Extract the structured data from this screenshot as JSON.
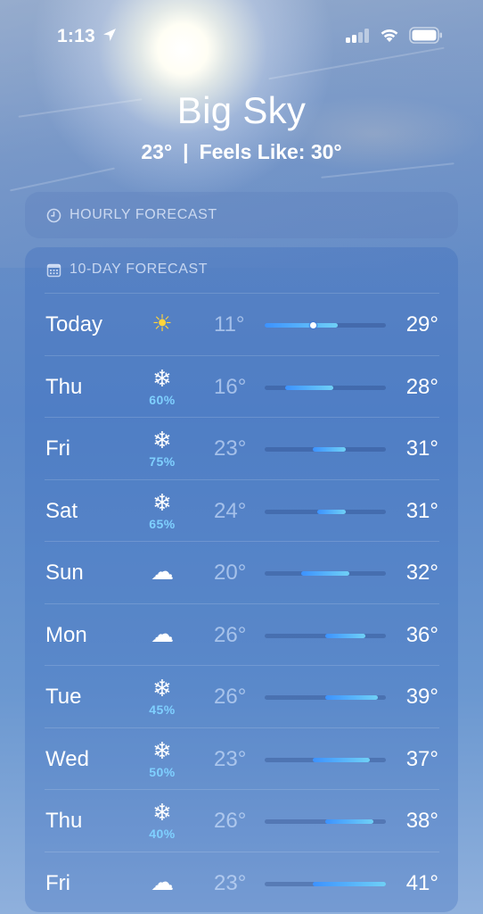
{
  "status_bar": {
    "time": "1:13",
    "location_icon": "location-arrow-icon",
    "signal_icon": "cellular-signal-icon",
    "wifi_icon": "wifi-icon",
    "battery_icon": "battery-icon"
  },
  "header": {
    "city": "Big Sky",
    "temperature": "23°",
    "separator": "|",
    "feels_like": "Feels Like: 30°"
  },
  "hourly_card": {
    "icon": "clock-icon",
    "title": "HOURLY FORECAST"
  },
  "ten_day_card": {
    "icon": "calendar-icon",
    "title": "10-DAY FORECAST",
    "range_min": 11,
    "range_max": 41,
    "current_temp": 23,
    "days": [
      {
        "day": "Today",
        "icon": "sun-icon",
        "glyph": "☀",
        "pop": "",
        "low": "11°",
        "high": "29°",
        "low_val": 11,
        "high_val": 29
      },
      {
        "day": "Thu",
        "icon": "snowflake-icon",
        "glyph": "❄",
        "pop": "60%",
        "low": "16°",
        "high": "28°",
        "low_val": 16,
        "high_val": 28
      },
      {
        "day": "Fri",
        "icon": "snowflake-icon",
        "glyph": "❄",
        "pop": "75%",
        "low": "23°",
        "high": "31°",
        "low_val": 23,
        "high_val": 31
      },
      {
        "day": "Sat",
        "icon": "snowflake-icon",
        "glyph": "❄",
        "pop": "65%",
        "low": "24°",
        "high": "31°",
        "low_val": 24,
        "high_val": 31
      },
      {
        "day": "Sun",
        "icon": "cloud-icon",
        "glyph": "☁",
        "pop": "",
        "low": "20°",
        "high": "32°",
        "low_val": 20,
        "high_val": 32
      },
      {
        "day": "Mon",
        "icon": "cloud-icon",
        "glyph": "☁",
        "pop": "",
        "low": "26°",
        "high": "36°",
        "low_val": 26,
        "high_val": 36
      },
      {
        "day": "Tue",
        "icon": "snowflake-icon",
        "glyph": "❄",
        "pop": "45%",
        "low": "26°",
        "high": "39°",
        "low_val": 26,
        "high_val": 39
      },
      {
        "day": "Wed",
        "icon": "snowflake-icon",
        "glyph": "❄",
        "pop": "50%",
        "low": "23°",
        "high": "37°",
        "low_val": 23,
        "high_val": 37
      },
      {
        "day": "Thu",
        "icon": "snowflake-icon",
        "glyph": "❄",
        "pop": "40%",
        "low": "26°",
        "high": "38°",
        "low_val": 26,
        "high_val": 38
      },
      {
        "day": "Fri",
        "icon": "cloud-icon",
        "glyph": "☁",
        "pop": "",
        "low": "23°",
        "high": "41°",
        "low_val": 23,
        "high_val": 41
      }
    ]
  }
}
